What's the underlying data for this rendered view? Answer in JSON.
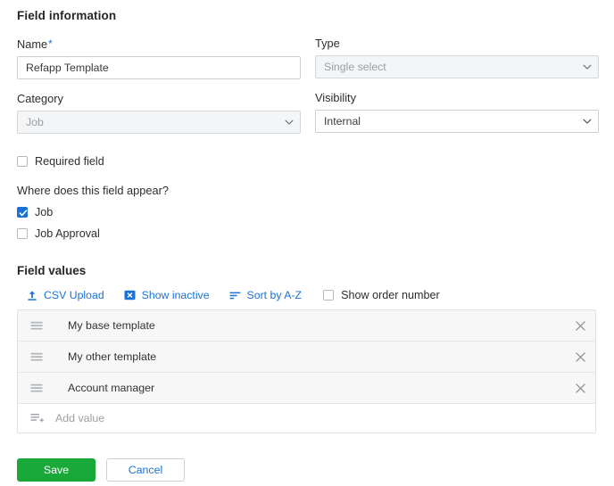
{
  "colors": {
    "accent_blue": "#1a73d4",
    "save_green": "#19a939",
    "border_gray": "#ccd0d4",
    "row_gray": "#f7f7f8",
    "disabled_gray": "#f4f5f6"
  },
  "field_information": {
    "title": "Field information",
    "name": {
      "label": "Name",
      "required_marker": "*",
      "value": "Refapp Template",
      "placeholder": ""
    },
    "type": {
      "label": "Type",
      "value": "Single select",
      "disabled": true,
      "chevron_icon": "chevron-down-icon"
    },
    "category": {
      "label": "Category",
      "value": "Job",
      "disabled": true,
      "chevron_icon": "chevron-down-icon"
    },
    "visibility": {
      "label": "Visibility",
      "value": "Internal",
      "disabled": false,
      "chevron_icon": "chevron-down-icon"
    },
    "required_field": {
      "label": "Required field",
      "checked": false
    }
  },
  "appearance": {
    "question": "Where does this field appear?",
    "options": [
      {
        "label": "Job",
        "checked": true
      },
      {
        "label": "Job Approval",
        "checked": false
      }
    ]
  },
  "field_values": {
    "title": "Field values",
    "toolbar": {
      "csv_upload": {
        "label": "CSV Upload",
        "icon": "upload-icon"
      },
      "show_inactive": {
        "label": "Show inactive",
        "icon": "hidden-box-icon"
      },
      "sort_az": {
        "label": "Sort by A-Z",
        "icon": "sort-lines-icon"
      },
      "show_order_number": {
        "label": "Show order number",
        "checked": false
      }
    },
    "rows": [
      {
        "text": "My base template",
        "drag_icon": "drag-handle-icon",
        "remove_icon": "close-icon"
      },
      {
        "text": "My other template",
        "drag_icon": "drag-handle-icon",
        "remove_icon": "close-icon"
      },
      {
        "text": "Account manager",
        "drag_icon": "drag-handle-icon",
        "remove_icon": "close-icon"
      }
    ],
    "add_row": {
      "placeholder": "Add value",
      "icon": "add-lines-icon"
    }
  },
  "footer": {
    "save_label": "Save",
    "cancel_label": "Cancel"
  }
}
